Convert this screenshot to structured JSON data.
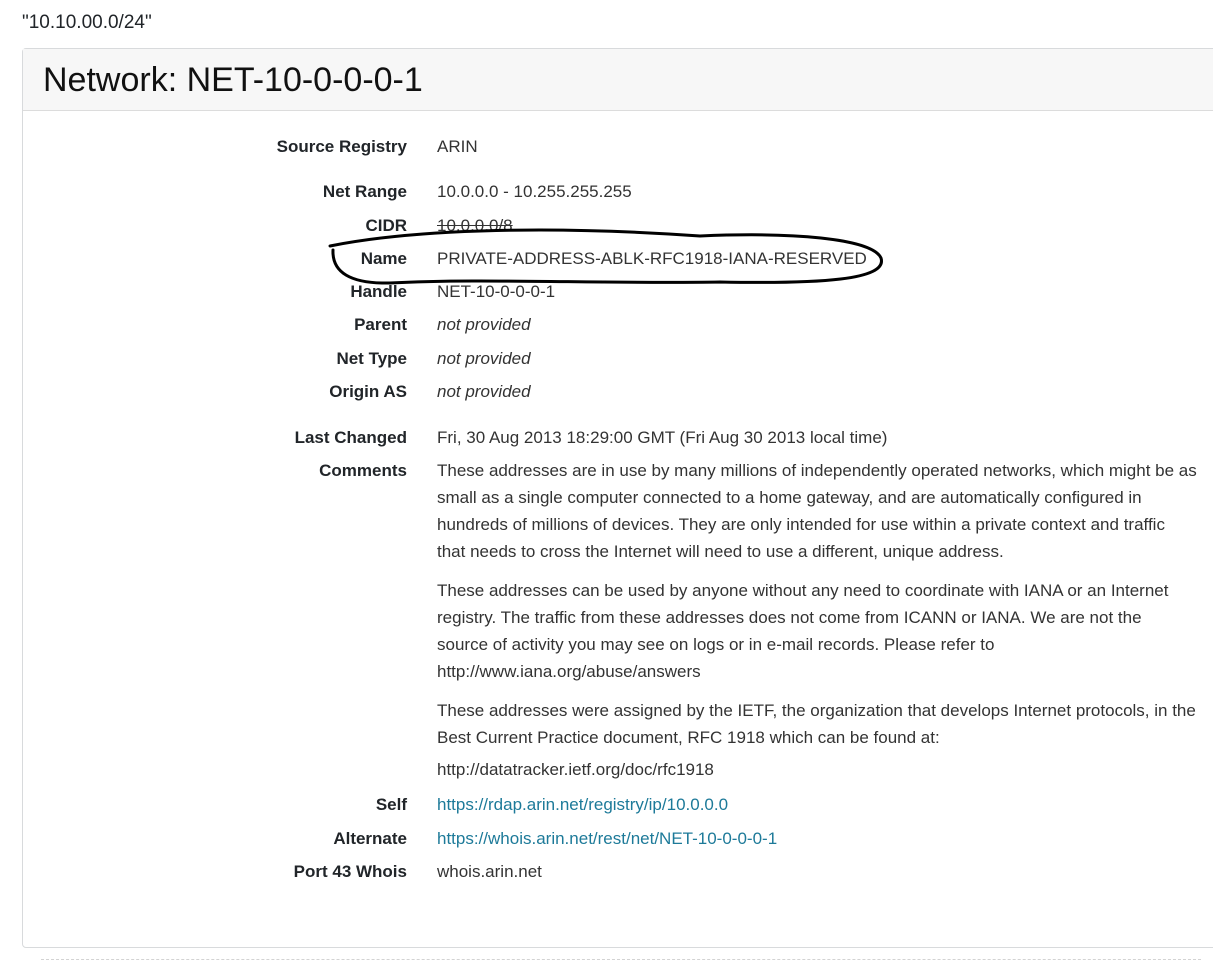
{
  "query": "\"10.10.00.0/24\"",
  "panel": {
    "title": "Network: NET-10-0-0-0-1"
  },
  "fields": {
    "source_registry": {
      "label": "Source Registry",
      "value": "ARIN"
    },
    "net_range": {
      "label": "Net Range",
      "value": "10.0.0.0 - 10.255.255.255"
    },
    "cidr": {
      "label": "CIDR",
      "value": "10.0.0.0/8"
    },
    "name": {
      "label": "Name",
      "value": "PRIVATE-ADDRESS-ABLK-RFC1918-IANA-RESERVED"
    },
    "handle": {
      "label": "Handle",
      "value": "NET-10-0-0-0-1"
    },
    "parent": {
      "label": "Parent",
      "value": "not provided"
    },
    "net_type": {
      "label": "Net Type",
      "value": "not provided"
    },
    "origin_as": {
      "label": "Origin AS",
      "value": "not provided"
    },
    "last_changed": {
      "label": "Last Changed",
      "value": "Fri, 30 Aug 2013 18:29:00 GMT (Fri Aug 30 2013 local time)"
    },
    "comments": {
      "label": "Comments",
      "paragraphs": [
        "These addresses are in use by many millions of independently operated networks, which might be as small as a single computer connected to a home gateway, and are automatically configured in hundreds of millions of devices. They are only intended for use within a private context and traffic that needs to cross the Internet will need to use a different, unique address.",
        "These addresses can be used by anyone without any need to coordinate with IANA or an Internet registry. The traffic from these addresses does not come from ICANN or IANA. We are not the source of activity you may see on logs or in e-mail records. Please refer to http://www.iana.org/abuse/answers",
        "These addresses were assigned by the IETF, the organization that develops Internet protocols, in the Best Current Practice document, RFC 1918 which can be found at:",
        "http://datatracker.ietf.org/doc/rfc1918"
      ]
    },
    "self": {
      "label": "Self",
      "value": "https://rdap.arin.net/registry/ip/10.0.0.0"
    },
    "alternate": {
      "label": "Alternate",
      "value": "https://whois.arin.net/rest/net/NET-10-0-0-0-1"
    },
    "port43": {
      "label": "Port 43 Whois",
      "value": "whois.arin.net"
    }
  },
  "colors": {
    "link": "#1d7a99",
    "header_bg": "#f7f7f7",
    "annotation_ink": "#000000"
  }
}
